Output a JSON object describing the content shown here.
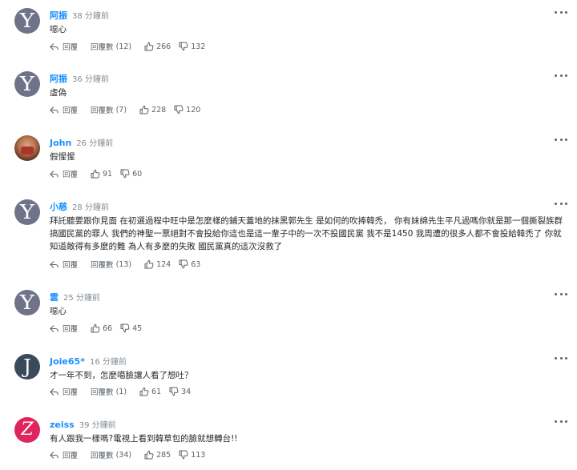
{
  "colors": {
    "accent": "#188fff",
    "text": "#26282a",
    "muted": "#828c93"
  },
  "labels": {
    "reply": "回覆",
    "replies_prefix": "回覆數"
  },
  "comments": [
    {
      "name": "阿振",
      "time": "38 分鐘前",
      "text": "噁心",
      "avatar": "Y",
      "replies": "(12)",
      "up": "266",
      "down": "132"
    },
    {
      "name": "阿振",
      "time": "36 分鐘前",
      "text": "虛偽",
      "avatar": "Y",
      "replies": "(7)",
      "up": "228",
      "down": "120"
    },
    {
      "name": "John",
      "time": "26 分鐘前",
      "text": "假惺惺",
      "avatar": "photo",
      "replies": "",
      "up": "91",
      "down": "60"
    },
    {
      "name": "小慈",
      "time": "28 分鐘前",
      "text": "拜託聽要跟你見面 在初選過程中旺中是怎麼樣的鋪天蓋地的抹黑郭先生 是如何的吹捧韓禿， 你有妹綿先生平凡過嗎你就是那一個撕裂族群搞國民黨的罪人 我們的神聖一票絕對不會投給你這也是這一輩子中的一次不投國民黨 我不是1450 我周遭的很多人都不會投給韓禿了 你就知道敵得有多麼的難 為人有多麼的失敗 國民黨真的這次沒救了",
      "avatar": "Y",
      "replies": "(13)",
      "up": "124",
      "down": "63"
    },
    {
      "name": "雲",
      "time": "25 分鐘前",
      "text": "噁心",
      "avatar": "Y",
      "replies": "",
      "up": "66",
      "down": "45"
    },
    {
      "name": "Joie65*",
      "time": "16 分鐘前",
      "text": "才一年不到，怎麼噶臉讓人看了想吐？",
      "avatar": "J",
      "replies": "(1)",
      "up": "61",
      "down": "34"
    },
    {
      "name": "zeiss",
      "time": "39 分鐘前",
      "text": "有人跟我一樣嗎?電視上看到韓草包的臉就想轉台!!",
      "avatar": "Z",
      "replies": "(34)",
      "up": "285",
      "down": "113"
    }
  ]
}
